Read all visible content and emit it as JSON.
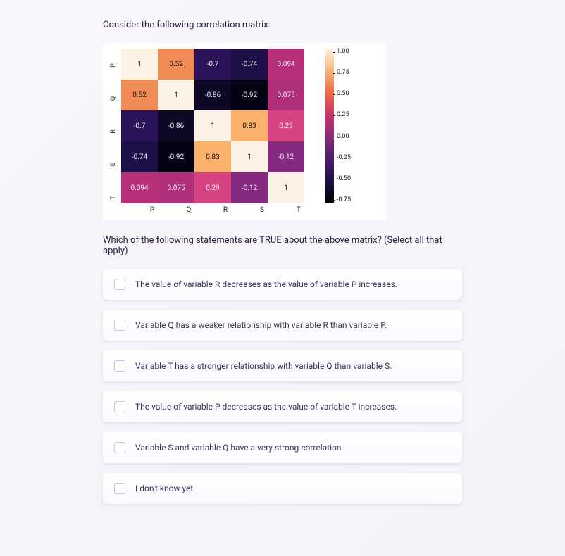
{
  "question_intro": "Consider the following correlation matrix:",
  "question_follow": "Which of the following statements are TRUE about the above matrix? (Select all that apply)",
  "vars": [
    "P",
    "Q",
    "R",
    "S",
    "T"
  ],
  "colorbar_ticks": [
    "1.00",
    "0.75",
    "0.50",
    "0.25",
    "0.00",
    "-0.25",
    "-0.50",
    "-0.75"
  ],
  "chart_data": {
    "type": "heatmap",
    "xlabels": [
      "P",
      "Q",
      "R",
      "S",
      "T"
    ],
    "ylabels": [
      "P",
      "Q",
      "R",
      "S",
      "T"
    ],
    "matrix": [
      [
        1,
        0.52,
        -0.7,
        -0.74,
        0.094
      ],
      [
        0.52,
        1,
        -0.86,
        -0.92,
        0.075
      ],
      [
        -0.7,
        -0.86,
        1,
        0.83,
        0.29
      ],
      [
        -0.74,
        -0.92,
        0.83,
        1,
        -0.12
      ],
      [
        0.094,
        0.075,
        0.29,
        -0.12,
        1
      ]
    ],
    "cell_text": [
      [
        "1",
        "0.52",
        "-0.7",
        "-0.74",
        "0.094"
      ],
      [
        "0.52",
        "1",
        "-0.86",
        "-0.92",
        "0.075"
      ],
      [
        "-0.7",
        "-0.86",
        "1",
        "0.83",
        "0.29"
      ],
      [
        "-0.74",
        "-0.92",
        "0.83",
        "1",
        "-0.12"
      ],
      [
        "0.094",
        "0.075",
        "0.29",
        "-0.12",
        "1"
      ]
    ],
    "cell_bg": [
      [
        "#fdf2e6",
        "#f18b56",
        "#2a1358",
        "#1e0f48",
        "#b6317a"
      ],
      [
        "#f18b56",
        "#fdf2e6",
        "#0c0826",
        "#040314",
        "#b02f7a"
      ],
      [
        "#2a1358",
        "#0c0826",
        "#fdf2e6",
        "#fbb06c",
        "#d84481"
      ],
      [
        "#1e0f48",
        "#040314",
        "#fbb06c",
        "#fdf2e6",
        "#852a80"
      ],
      [
        "#b6317a",
        "#b02f7a",
        "#d84481",
        "#852a80",
        "#fdf2e6"
      ]
    ],
    "cell_fg": [
      [
        "#111",
        "#111",
        "#eee",
        "#eee",
        "#eee"
      ],
      [
        "#111",
        "#111",
        "#eee",
        "#eee",
        "#eee"
      ],
      [
        "#eee",
        "#eee",
        "#111",
        "#111",
        "#eee"
      ],
      [
        "#eee",
        "#eee",
        "#111",
        "#111",
        "#eee"
      ],
      [
        "#eee",
        "#eee",
        "#eee",
        "#eee",
        "#111"
      ]
    ],
    "color_range": [
      -0.75,
      1.0
    ]
  },
  "options": [
    "The value of variable R decreases as the value of variable P increases.",
    "Variable Q has a weaker relationship with variable R than variable P.",
    "Variable T has a stronger relationship with variable Q than variable S.",
    "The value of variable P decreases as the value of variable T increases.",
    "Variable S and variable Q have a very strong correlation.",
    "I don't know yet"
  ]
}
